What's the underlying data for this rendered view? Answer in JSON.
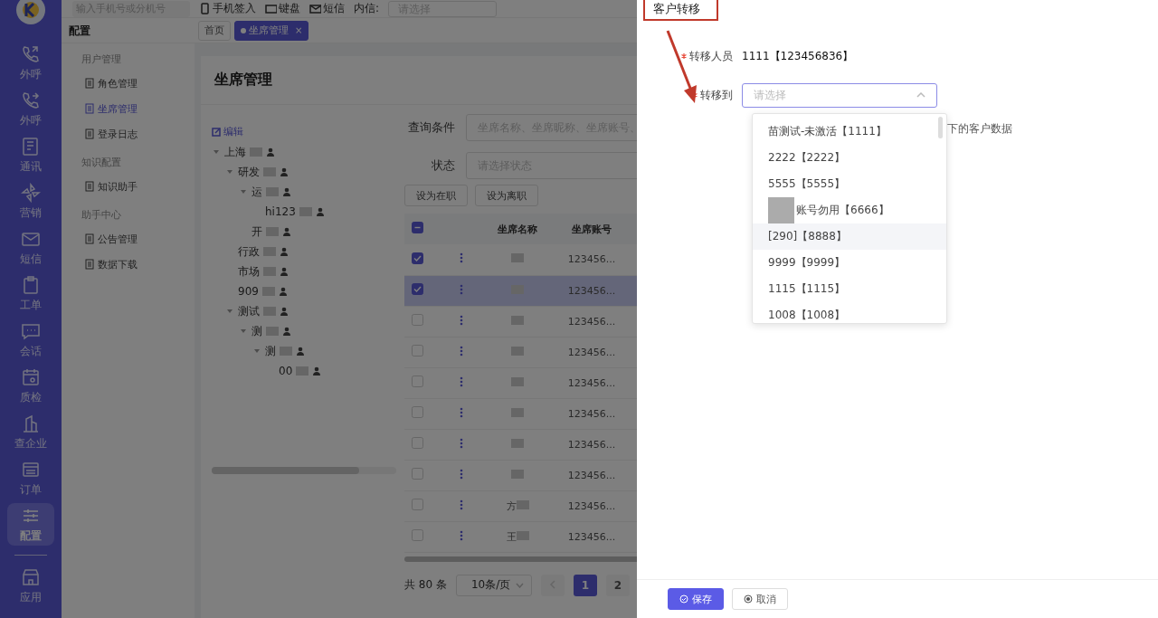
{
  "nav": {
    "items": [
      {
        "label": "外呼",
        "selected": false
      },
      {
        "label": "外呼",
        "selected": false
      },
      {
        "label": "通讯",
        "selected": false
      },
      {
        "label": "营销",
        "selected": false
      },
      {
        "label": "短信",
        "selected": false
      },
      {
        "label": "工单",
        "selected": false
      },
      {
        "label": "会话",
        "selected": false
      },
      {
        "label": "质检",
        "selected": false
      },
      {
        "label": "查企业",
        "selected": false
      },
      {
        "label": "订单",
        "selected": false
      },
      {
        "label": "配置",
        "selected": true
      }
    ],
    "bottom": {
      "label": "应用"
    }
  },
  "topbar": {
    "search_placeholder": "输入手机号或分机号",
    "items": [
      "手机签入",
      "键盘",
      "短信"
    ],
    "inner_label": "内信:",
    "inner_placeholder": "请选择"
  },
  "menu": {
    "title": "配置",
    "groups": [
      {
        "title": "用户管理",
        "items": [
          {
            "label": "角色管理",
            "selected": false
          },
          {
            "label": "坐席管理",
            "selected": true
          },
          {
            "label": "登录日志",
            "selected": false
          }
        ]
      },
      {
        "title": "知识配置",
        "items": [
          {
            "label": "知识助手",
            "selected": false
          }
        ]
      },
      {
        "title": "助手中心",
        "items": [
          {
            "label": "公告管理",
            "selected": false
          },
          {
            "label": "数据下载",
            "selected": false
          }
        ]
      }
    ]
  },
  "tabs": [
    {
      "label": "首页",
      "selected": false
    },
    {
      "label": "坐席管理",
      "selected": true,
      "close": "×"
    }
  ],
  "page": {
    "title": "坐席管理",
    "edit": "编辑",
    "tree": [
      {
        "label": "上海",
        "expanded": true,
        "children": [
          {
            "label": "研发",
            "expanded": true,
            "children": [
              {
                "label": "运",
                "expanded": true,
                "children": [
                  {
                    "label": "hi123"
                  }
                ]
              },
              {
                "label": "开"
              }
            ]
          },
          {
            "label": "行政"
          },
          {
            "label": "市场"
          },
          {
            "label": "909"
          },
          {
            "label": "测试",
            "expanded": true,
            "children": [
              {
                "label": "测",
                "expanded": true,
                "children": [
                  {
                    "label": "测",
                    "expanded": true,
                    "children": [
                      {
                        "label": "00"
                      }
                    ]
                  }
                ]
              }
            ]
          }
        ]
      }
    ],
    "query_label": "查询条件",
    "query_placeholder": "坐席名称、坐席昵称、坐席账号、",
    "status_label": "状态",
    "status_placeholder": "请选择状态",
    "actions": [
      "设为在职",
      "设为离职"
    ],
    "table": {
      "select_all_indeterminate": true,
      "columns": [
        "坐席名称",
        "坐席账号"
      ],
      "rows": [
        {
          "checked": true,
          "selected": false,
          "account": "123456..."
        },
        {
          "checked": true,
          "selected": true,
          "account": "123456..."
        },
        {
          "checked": false,
          "selected": false,
          "account": "123456..."
        },
        {
          "checked": false,
          "selected": false,
          "account": "123456..."
        },
        {
          "checked": false,
          "selected": false,
          "account": "123456..."
        },
        {
          "checked": false,
          "selected": false,
          "account": "123456..."
        },
        {
          "checked": false,
          "selected": false,
          "account": "123456..."
        },
        {
          "checked": false,
          "selected": false,
          "account": "123456..."
        },
        {
          "checked": false,
          "selected": false,
          "name": "方",
          "account": "123456..."
        },
        {
          "checked": false,
          "selected": false,
          "name": "王",
          "account": "123456..."
        }
      ]
    },
    "pagination": {
      "total": "共 80 条",
      "page_size": "10条/页",
      "pages": [
        {
          "label": "1",
          "selected": true
        },
        {
          "label": "2",
          "selected": false
        }
      ]
    }
  },
  "drawer": {
    "title": "客户转移",
    "fields": [
      {
        "label": "转移人员",
        "required": true,
        "kind": "text",
        "value": "1111【123456836】"
      },
      {
        "label": "转移到",
        "required": true,
        "kind": "select",
        "placeholder": "请选择",
        "open": true
      }
    ],
    "hint": "下的客户数据",
    "options": [
      {
        "label": "苗测试-未激活【1111】",
        "hovered": false
      },
      {
        "label": "2222【2222】",
        "hovered": false
      },
      {
        "label": "5555【5555】",
        "hovered": false
      },
      {
        "label": "账号勿用【6666】",
        "hovered": false,
        "redacted": true
      },
      {
        "label": "[290]【8888】",
        "hovered": true
      },
      {
        "label": "9999【9999】",
        "hovered": false
      },
      {
        "label": "1115【1115】",
        "hovered": false
      },
      {
        "label": "1008【1008】",
        "hovered": false
      }
    ],
    "buttons": [
      {
        "label": "保存",
        "kind": "primary"
      },
      {
        "label": "取消",
        "kind": "default"
      }
    ]
  }
}
